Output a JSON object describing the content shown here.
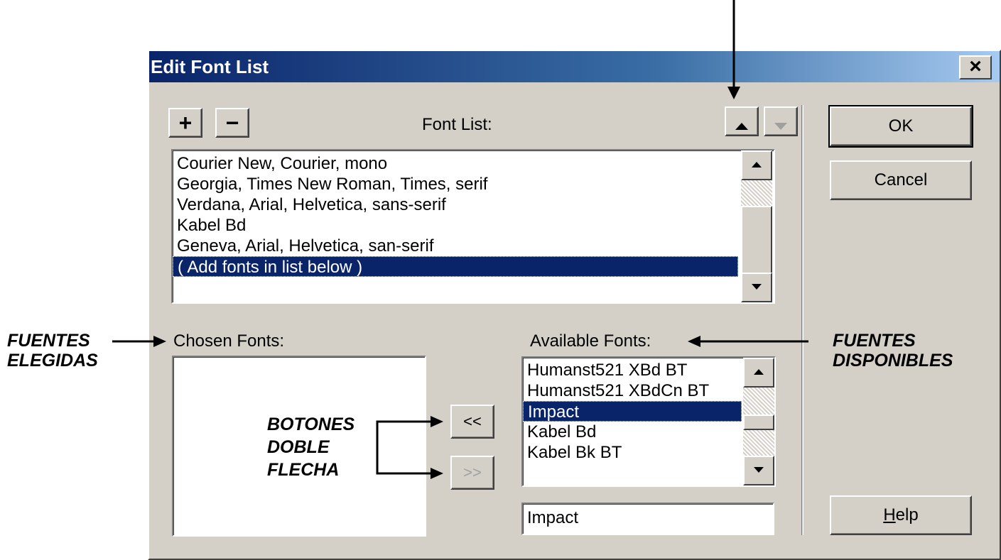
{
  "dialog": {
    "title": "Edit Font List",
    "close_glyph": "×",
    "add_label": "+",
    "remove_label": "−",
    "font_list_label": "Font List:",
    "move_up_icon": "triangle-up",
    "move_down_icon": "triangle-down",
    "font_list_items": [
      "Courier New, Courier, mono",
      "Georgia, Times New Roman, Times, serif",
      "Verdana, Arial, Helvetica, sans-serif",
      "Kabel Bd",
      "Geneva, Arial, Helvetica, san-serif",
      "( Add fonts in list below )"
    ],
    "font_list_selected_index": 5,
    "chosen_fonts_label": "Chosen Fonts:",
    "chosen_fonts_items": [],
    "add_chosen_label": "<<",
    "remove_chosen_label": ">>",
    "available_fonts_label": "Available Fonts:",
    "available_fonts_items": [
      "Humanst521 XBd BT",
      "Humanst521 XBdCn BT",
      "Impact",
      "Kabel Bd",
      "Kabel Bk BT"
    ],
    "available_fonts_selected_index": 2,
    "available_font_input_value": "Impact",
    "ok_label": "OK",
    "cancel_label": "Cancel",
    "help_label": "Help",
    "help_accel": "H",
    "help_rest": "elp"
  },
  "annotations": {
    "chosen": [
      "FUENTES",
      "ELEGIDAS"
    ],
    "available": [
      "FUENTES",
      "DISPONIBLES"
    ],
    "double_arrow": [
      "BOTONES",
      "DOBLE",
      "FLECHA"
    ]
  },
  "colors": {
    "titlebar_start": "#0a246a",
    "titlebar_end": "#a6caf0",
    "dialog_face": "#d4d0c8",
    "selection": "#0a246a"
  }
}
